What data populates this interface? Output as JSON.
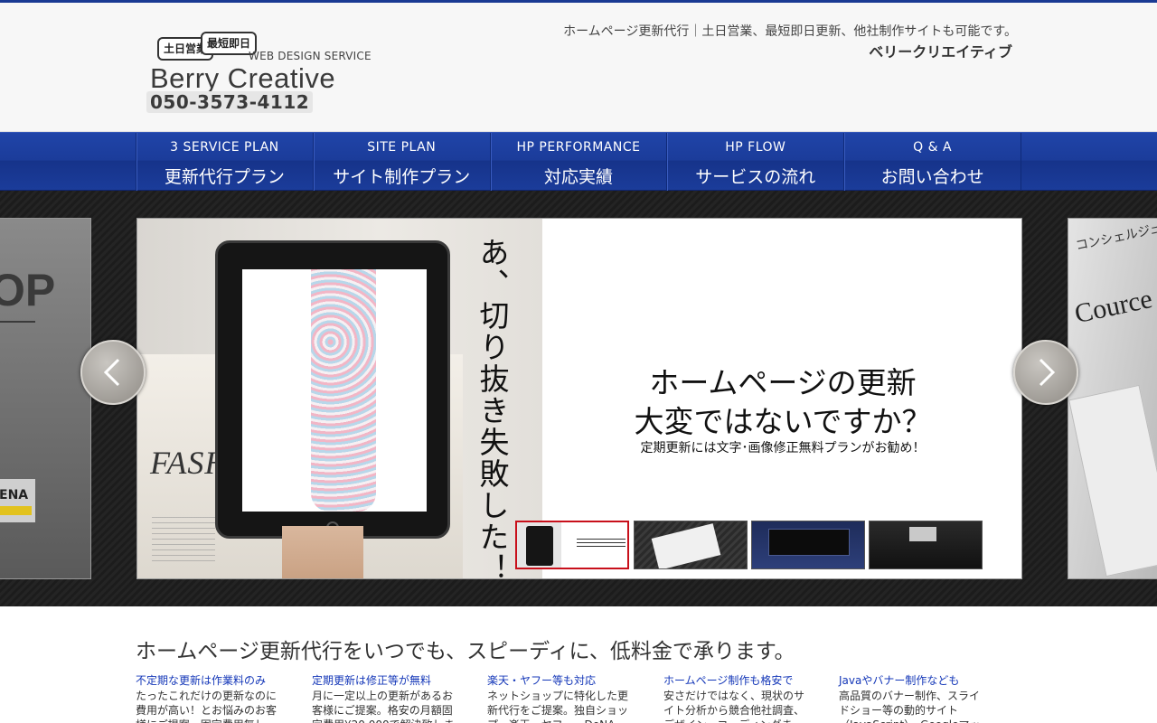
{
  "header": {
    "bubble_1": "土日営業",
    "bubble_2": "最短即日",
    "logo_sub": "WEB DESIGN SERVICE",
    "logo_name": "Berry Creative",
    "phone": "050-3573-4112",
    "tagline": "ホームページ更新代行｜土日営業、最短即日更新、他社制作サイトも可能です。",
    "company": "ベリークリエイティブ"
  },
  "nav": [
    {
      "en": "3 SERVICE PLAN",
      "jp": "更新代行プラン"
    },
    {
      "en": "SITE PLAN",
      "jp": "サイト制作プラン"
    },
    {
      "en": "HP PERFORMANCE",
      "jp": "対応実績"
    },
    {
      "en": "HP FLOW",
      "jp": "サービスの流れ"
    },
    {
      "en": "Q & A",
      "jp": "お問い合わせ"
    }
  ],
  "slider": {
    "left_peek_text": "OP",
    "left_peek_tag": "ENA",
    "right_peek_text_1": "コンシェルジュ・SHINとは",
    "right_peek_text_2": "Cource P",
    "photo_text": "FASHION MAG",
    "vertical_text": "あ、切り抜き失敗した！",
    "headline_1": "ホームページの更新",
    "headline_2": "大変ではないですか？",
    "subline": "定期更新には文字･画像修正無料プランがお勧め！",
    "active_thumb": 1,
    "thumb_count": 4,
    "colors": {
      "highlight": "#c8101b",
      "background": "#1c1c1c"
    }
  },
  "content": {
    "title": "ホームページ更新代行をいつでも、スピーディに、低料金で承ります。",
    "columns": [
      {
        "heading": "不定期な更新は作業料のみ",
        "body": "たったこれだけの更新なのに費用が高い！とお悩みのお客様にご提案。固定費用無し"
      },
      {
        "heading": "定期更新は修正等が無料",
        "body": "月に一定以上の更新があるお客様にご提案。格安の月額固定費用¥20,000で解決致しま"
      },
      {
        "heading": "楽天・ヤフー等も対応",
        "body": "ネットショップに特化した更新代行をご提案。独自ショップ、楽天、ヤフー、DeNA"
      },
      {
        "heading": "ホームページ制作も格安で",
        "body": "安さだけではなく、現状のサイト分析から競合他社調査、デザイン、コーディングま"
      },
      {
        "heading": "Javaやバナー制作なども",
        "body": "高品質のバナー制作、スライドショー等の動的サイト（JavaScript）、Googleマッ"
      }
    ]
  },
  "theme": {
    "nav_blue": "#1b3c9a",
    "link_blue": "#1437b8"
  }
}
